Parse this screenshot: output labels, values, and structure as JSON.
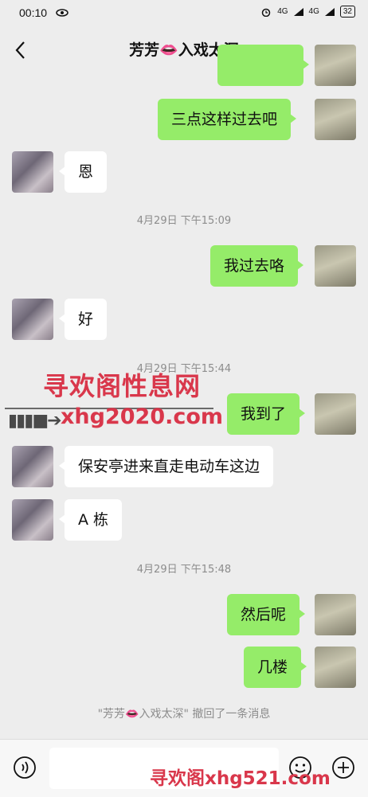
{
  "status_bar": {
    "time": "00:10",
    "signal1": "4G",
    "signal2": "4G",
    "battery": "32"
  },
  "header": {
    "title": "芳芳👄入戏太深"
  },
  "messages": [
    {
      "side": "right",
      "text": "三点这样过去吧"
    },
    {
      "side": "left",
      "text": "恩"
    },
    {
      "side": "right",
      "text": "我过去咯"
    },
    {
      "side": "left",
      "text": "好"
    },
    {
      "side": "right",
      "text": "我到了"
    },
    {
      "side": "left",
      "text": "保安亭进来直走电动车这边"
    },
    {
      "side": "left",
      "text": "A 栋"
    },
    {
      "side": "right",
      "text": "然后呢"
    },
    {
      "side": "right",
      "text": "几楼"
    }
  ],
  "timestamps": [
    "4月29日 下午15:09",
    "4月29日 下午15:44",
    "4月29日 下午15:48"
  ],
  "recall_notice": "\"芳芳👄入戏太深\" 撤回了一条消息",
  "watermarks": {
    "title": "寻欢阁性息网",
    "url": "xhg2020.com",
    "footer": "寻欢阁xhg521.com"
  },
  "colors": {
    "bubble_right": "#95ec69",
    "bubble_left": "#ffffff",
    "background": "#ededed",
    "watermark": "#d9374b"
  }
}
